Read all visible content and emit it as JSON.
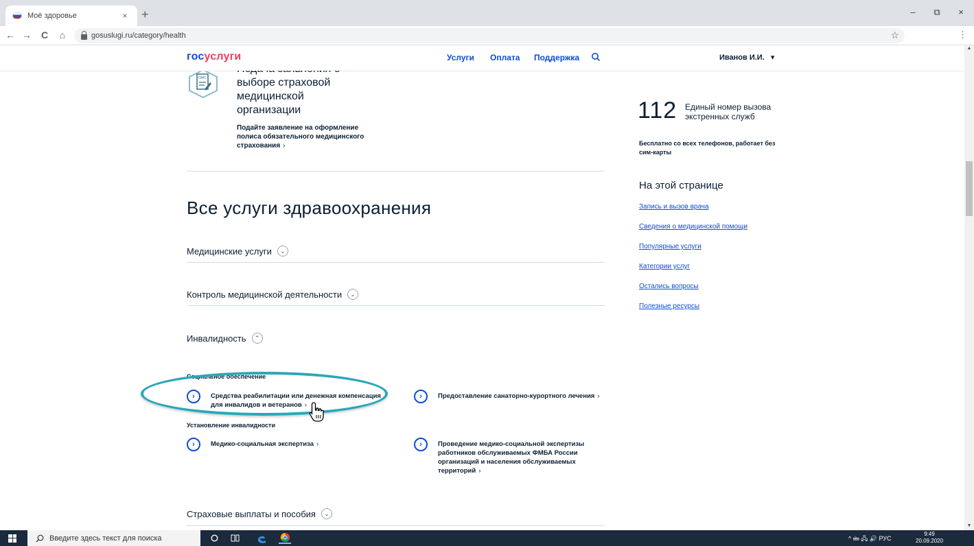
{
  "browser": {
    "tab_title": "Моё здоровье",
    "tab_close": "×",
    "new_tab": "+",
    "url": "gosuslugi.ru/category/health",
    "minimize": "–",
    "maximize": "⧉",
    "close": "×",
    "back": "←",
    "forward": "→",
    "reload": "C",
    "home": "⌂",
    "bookmark": "☆",
    "menu": "⋮"
  },
  "header": {
    "logo_part1": "гос",
    "logo_part2": "услуги",
    "nav": [
      "Услуги",
      "Оплата",
      "Поддержка"
    ],
    "user_name": "Иванов И.И.",
    "user_chevron": "▾"
  },
  "top_card": {
    "icon_label": "ОМС",
    "title": "Подача заявления о выборе страховой медицинской организации",
    "description": "Подайте заявление на оформление полиса обязательного медицинского страхования",
    "chevron": "›"
  },
  "main": {
    "section_title": "Все услуги здравоохранения",
    "accordions": [
      {
        "label": "Медицинские услуги",
        "toggle": "⌄"
      },
      {
        "label": "Контроль медицинской деятельности",
        "toggle": "⌄"
      },
      {
        "label": "Инвалидность",
        "toggle": "⌃"
      },
      {
        "label": "Страховые выплаты и пособия",
        "toggle": "⌄"
      }
    ],
    "subgroups": [
      {
        "title": "Социальное обеспечение",
        "services": [
          {
            "text": "Средства реабилитации или денежная компенсация для инвалидов и ветеранов",
            "chevron": "›"
          },
          {
            "text": "Предоставление санаторно-курортного лечения",
            "chevron": "›"
          }
        ]
      },
      {
        "title": "Установление инвалидности",
        "services": [
          {
            "text": "Медико-социальная экспертиза",
            "chevron": "›"
          },
          {
            "text": "Проведение медико-социальной экспертизы работников обслуживаемых ФМБА России организаций и населения обслуживаемых территорий",
            "chevron": "›"
          }
        ]
      }
    ],
    "service_icon": "›"
  },
  "sidebar": {
    "emergency_number": "112",
    "emergency_title": "Единый номер вызова экстренных служб",
    "emergency_desc": "Бесплатно со всех телефонов, работает без сим-карты",
    "onpage_title": "На этой странице",
    "links": [
      "Запись и вызов врача",
      "Сведения о медицинской помощи",
      "Популярные услуги",
      "Категории услуг",
      "Остались вопросы",
      "Полезные ресурсы"
    ]
  },
  "taskbar": {
    "search_placeholder": "Введите здесь текст для поиска",
    "tray_text": "^  🖮  🖧  🔊  РУС",
    "time": "9:49",
    "date": "20.09.2020"
  },
  "colors": {
    "brand_blue": "#0d4cd3",
    "brand_red": "#ee3f58",
    "highlight": "#2aa8b8"
  }
}
